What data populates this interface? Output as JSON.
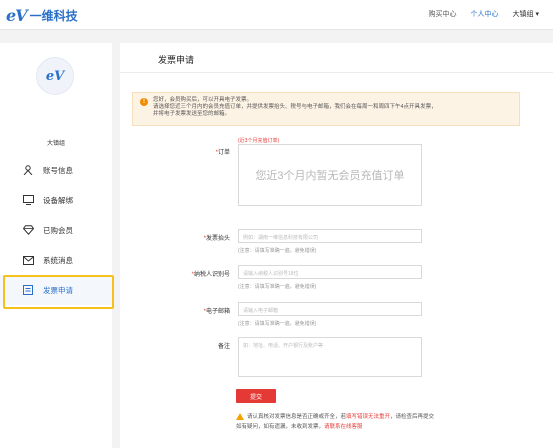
{
  "header": {
    "logo_mark": "eV",
    "logo_text": "一维科技",
    "nav": {
      "buy": "购买中心",
      "personal": "个人中心",
      "user": "大镇组 ▾"
    }
  },
  "sidebar": {
    "avatar_mark": "eV",
    "username": "大镇组",
    "items": [
      {
        "label": "账号信息",
        "icon": "person-icon"
      },
      {
        "label": "设备解绑",
        "icon": "monitor-icon"
      },
      {
        "label": "已购会员",
        "icon": "diamond-icon"
      },
      {
        "label": "系统消息",
        "icon": "mail-icon"
      },
      {
        "label": "发票申请",
        "icon": "invoice-icon"
      }
    ]
  },
  "main": {
    "title": "发票申请",
    "notice": {
      "line1": "您好，会员购买后，可以开具电子发票。",
      "line2": "请选择您近三个月内的会员充值订单，并提供发票抬头、税号与电子邮箱，我们会在每周一和周四下午4点开具发票，",
      "line3": "并将电子发票发送至您的邮箱。"
    },
    "order": {
      "label": "订单",
      "hint": "(近3个月充值订单)",
      "empty": "您近3个月内暂无会员充值订单"
    },
    "title_field": {
      "label": "发票抬头",
      "placeholder": "例如：湖南一维信息科技有限公司",
      "note": "(注意：请填写准确一遍，避免错误)"
    },
    "tax_field": {
      "label": "纳税人识别号",
      "placeholder": "请输入纳税人识别号18位",
      "note": "(注意：请填写准确一遍，避免错误)"
    },
    "email_field": {
      "label": "电子邮箱",
      "placeholder": "请输入电子邮箱",
      "note": "(注意：请填写准确一遍，避免错误)"
    },
    "remark_field": {
      "label": "备注",
      "placeholder": "如：地址、电话、开户银行及账户等"
    },
    "submit": "提交",
    "footer": {
      "part1": "请认真核对发票信息是否正确或齐全，若",
      "part2": "填写错误无法重开",
      "part3": "，请检查后再提交",
      "part4": "如有疑问，如有遗漏，未收到发票，",
      "part5": "请联系在线客服"
    }
  }
}
